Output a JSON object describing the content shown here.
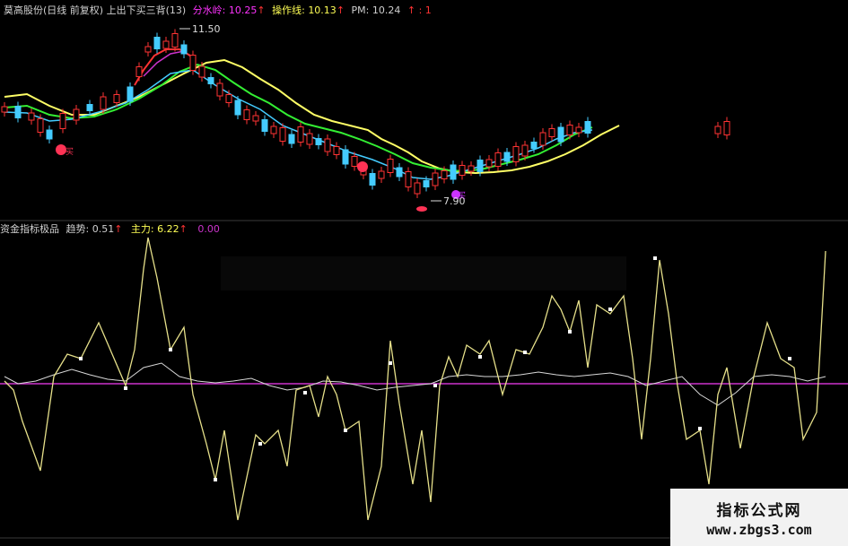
{
  "top_panel": {
    "stock_label": "莫高股份(日线 前复权)",
    "indicator_label": "上出下买三背(13)",
    "fenshuiling": {
      "label": "分水岭: ",
      "value": "10.25"
    },
    "caozuoxian": {
      "label": "操作线: ",
      "value": "10.13"
    },
    "pm": {
      "label": "PM: ",
      "value": "10.24"
    },
    "extra": "↑ : 1",
    "up_arrow": "↑",
    "high_marker": "11.50",
    "low_marker": "7.90",
    "buy_glyph": "买",
    "colors": {
      "magenta": "#ff33ff",
      "yellow": "#ffff55",
      "white": "#d0d0d0",
      "red": "#ff3333",
      "cyan": "#44ccff",
      "green": "#44ff44",
      "ma_yellow": "#ffff66"
    }
  },
  "bottom_panel": {
    "label": "资金指标极品",
    "trend": {
      "label": "趋势: ",
      "value": "0.51"
    },
    "zhuli": {
      "label": "主力: ",
      "value": "6.22"
    },
    "zero_value": "0.00",
    "up_arrow": "↑"
  },
  "watermark": {
    "line1": "指标公式网",
    "line2": "www.zbgs3.com"
  },
  "chart_data": [
    {
      "type": "candlestick",
      "title": "莫高股份(日线 前复权)",
      "annotations": [
        "11.50",
        "7.90"
      ],
      "series": [
        {
          "name": "分水岭",
          "last": 10.25
        },
        {
          "name": "操作线",
          "last": 10.13
        },
        {
          "name": "PM",
          "last": 10.24
        }
      ]
    },
    {
      "type": "line",
      "title": "资金指标极品",
      "series": [
        {
          "name": "趋势",
          "last": 0.51
        },
        {
          "name": "主力",
          "last": 6.22
        }
      ],
      "zero_line": 0.0
    }
  ]
}
